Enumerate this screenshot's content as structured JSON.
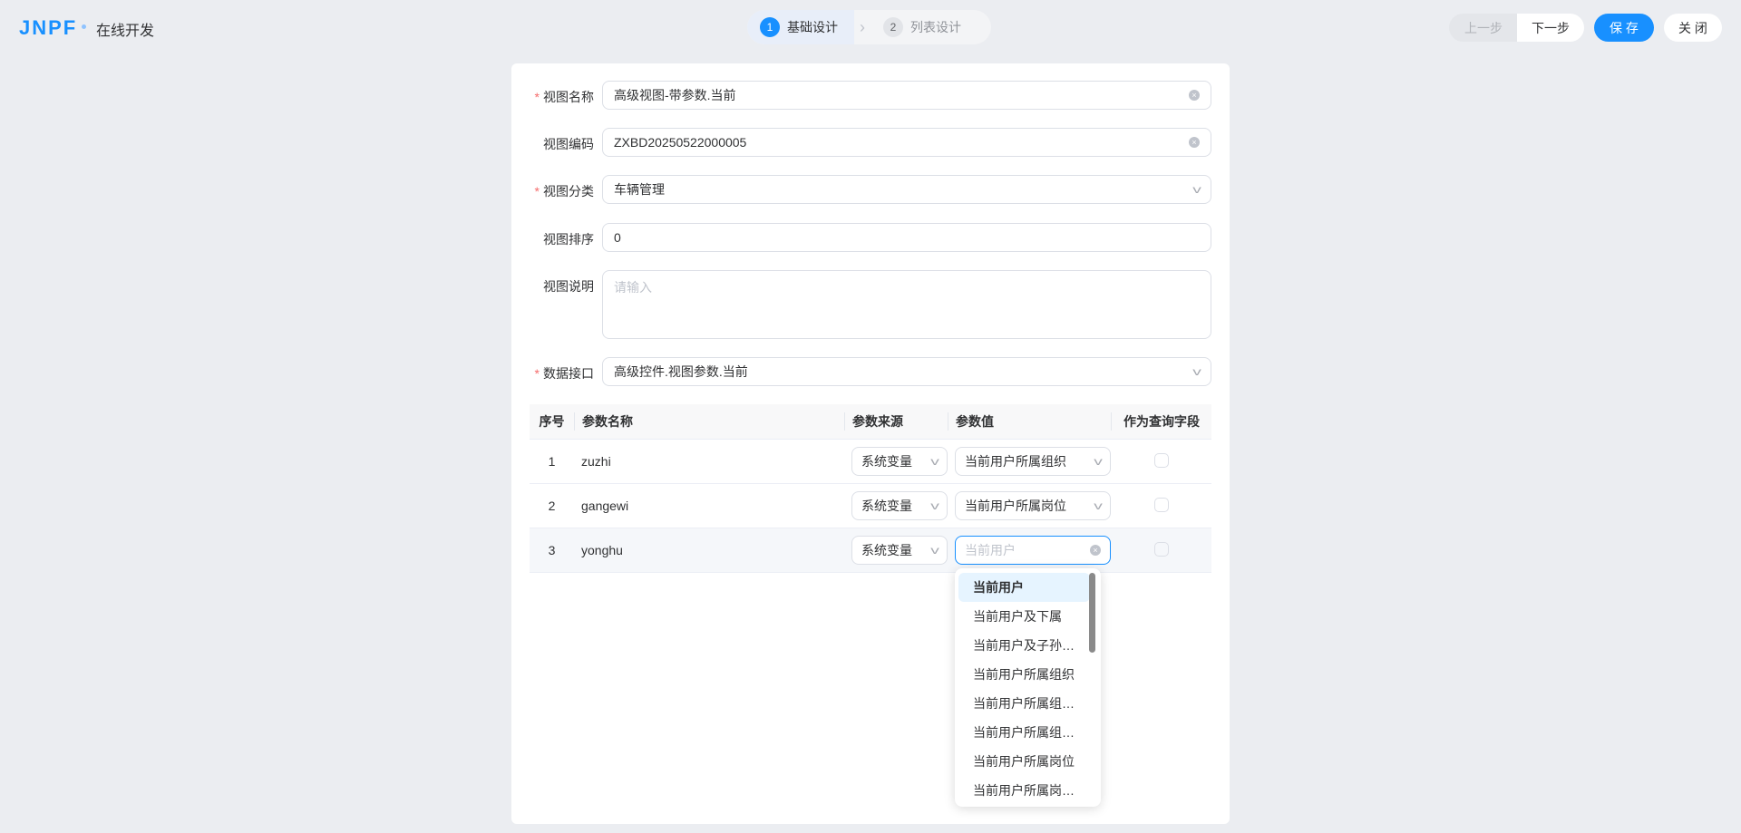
{
  "header": {
    "logo": "JNPF",
    "title": "在线开发",
    "steps": [
      {
        "num": "1",
        "label": "基础设计"
      },
      {
        "num": "2",
        "label": "列表设计"
      }
    ],
    "buttons": {
      "prev": "上一步",
      "next": "下一步",
      "save": "保 存",
      "close": "关 闭"
    }
  },
  "form": {
    "name": {
      "label": "视图名称",
      "value": "高级视图-带参数.当前"
    },
    "code": {
      "label": "视图编码",
      "value": "ZXBD20250522000005"
    },
    "category": {
      "label": "视图分类",
      "value": "车辆管理"
    },
    "sort": {
      "label": "视图排序",
      "value": "0"
    },
    "desc": {
      "label": "视图说明",
      "placeholder": "请输入"
    },
    "api": {
      "label": "数据接口",
      "value": "高级控件.视图参数.当前"
    },
    "required": "*"
  },
  "table": {
    "headers": [
      "序号",
      "参数名称",
      "参数来源",
      "参数值",
      "作为查询字段"
    ],
    "rows": [
      {
        "index": "1",
        "name": "zuzhi",
        "source": "系统变量",
        "value": "当前用户所属组织"
      },
      {
        "index": "2",
        "name": "gangewi",
        "source": "系统变量",
        "value": "当前用户所属岗位"
      },
      {
        "index": "3",
        "name": "yonghu",
        "source": "系统变量",
        "placeholder": "当前用户"
      }
    ]
  },
  "dropdown": {
    "options": [
      "当前用户",
      "当前用户及下属",
      "当前用户及子孙下属",
      "当前用户所属组织",
      "当前用户所属组织...",
      "当前用户所属组织...",
      "当前用户所属岗位",
      "当前用户所属岗位..."
    ],
    "selected": "当前用户"
  },
  "colors": {
    "accent": "#1890ff",
    "required": "#f56c6c"
  }
}
